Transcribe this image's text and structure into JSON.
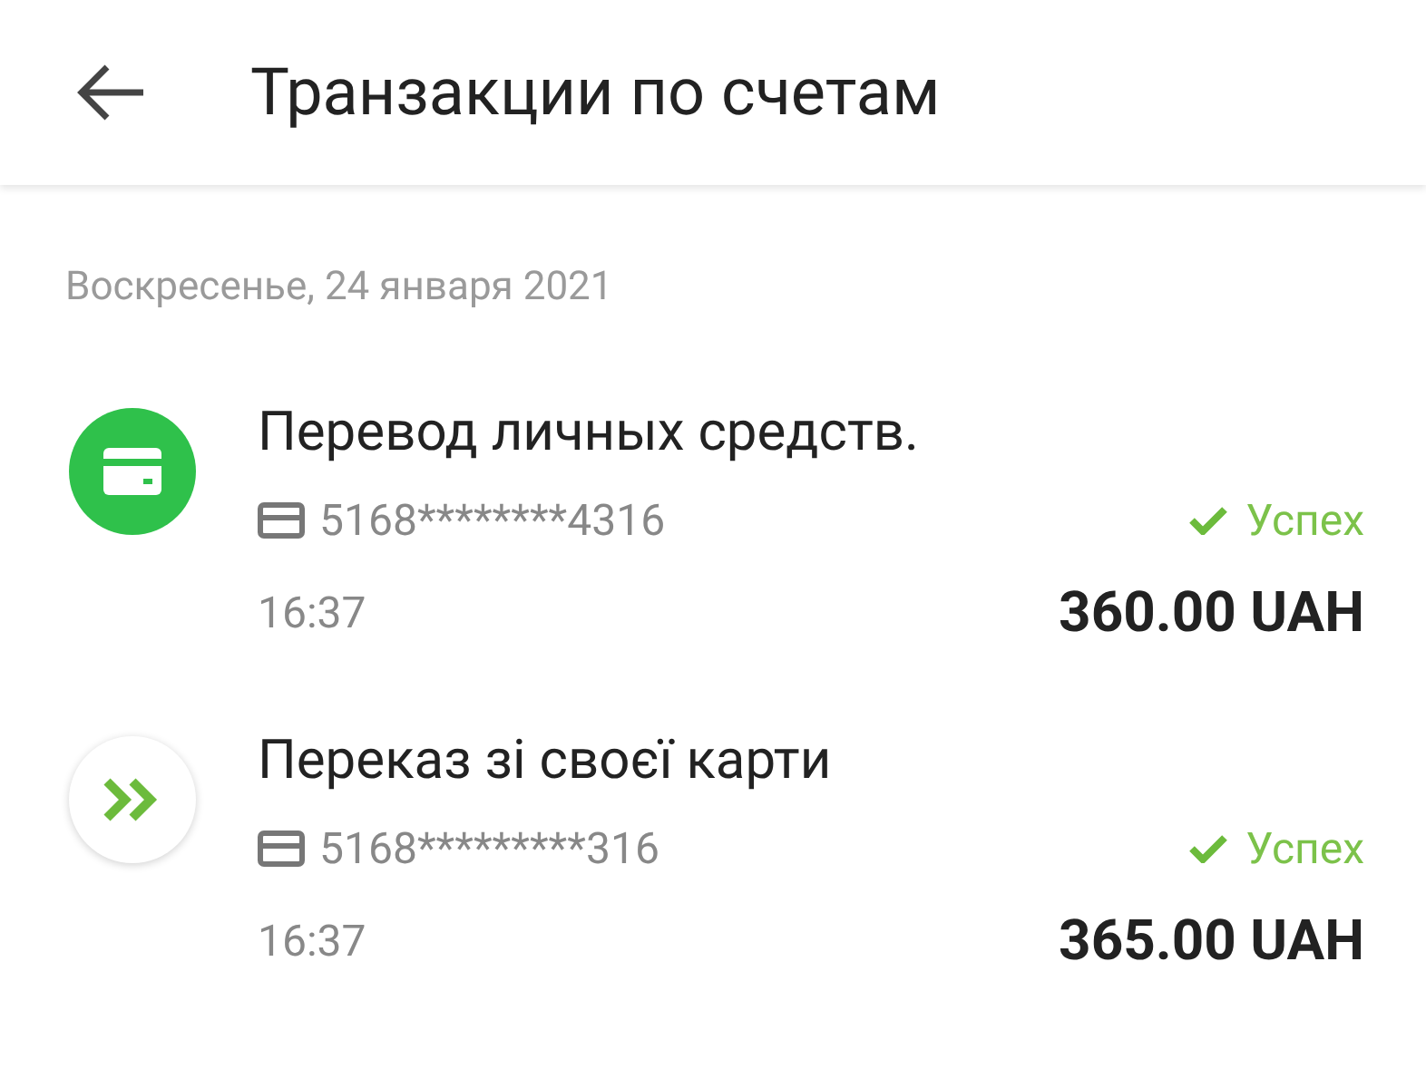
{
  "header": {
    "title": "Транзакции по счетам"
  },
  "date": "Воскресенье, 24 января 2021",
  "transactions": [
    {
      "kind": "card",
      "title": "Перевод личных средств.",
      "card": "5168********4316",
      "status": "Успех",
      "time": "16:37",
      "amount": "360.00 UAH"
    },
    {
      "kind": "transfer",
      "title": "Переказ зі своєї карти",
      "card": "5168*********316",
      "status": "Успех",
      "time": "16:37",
      "amount": "365.00 UAH"
    }
  ]
}
